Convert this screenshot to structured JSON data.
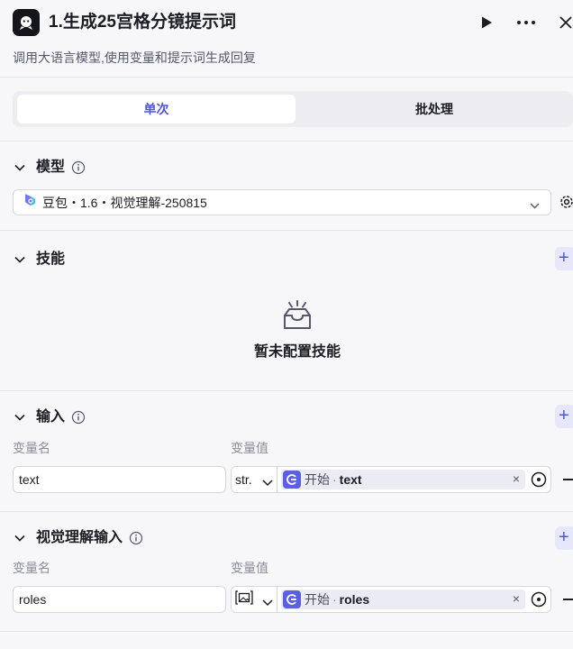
{
  "header": {
    "title": "1.生成25宫格分镜提示词",
    "subtitle": "调用大语言模型,使用变量和提示词生成回复",
    "icons": {
      "app": "llm-node-icon",
      "run": "play-icon",
      "more": "more-icon",
      "close": "close-icon"
    }
  },
  "mode_tabs": {
    "single": "单次",
    "batch": "批处理",
    "active": "single"
  },
  "model_section": {
    "title": "模型",
    "selected_model": "豆包・1.6・视觉理解-250815"
  },
  "skills_section": {
    "title": "技能",
    "empty_text": "暂未配置技能"
  },
  "input_section": {
    "title": "输入",
    "col_name": "变量名",
    "col_value": "变量值",
    "rows": [
      {
        "name": "text",
        "type": "str.",
        "ref_node": "开始",
        "ref_var": "text"
      }
    ]
  },
  "vision_section": {
    "title": "视觉理解输入",
    "col_name": "变量名",
    "col_value": "变量值",
    "rows": [
      {
        "name": "roles",
        "type_icon": "image-type-icon",
        "ref_node": "开始",
        "ref_var": "roles"
      }
    ]
  },
  "colors": {
    "accent": "#4d53e8",
    "ref_icon": "#5a5fe6",
    "background": "#f7f7fa"
  }
}
